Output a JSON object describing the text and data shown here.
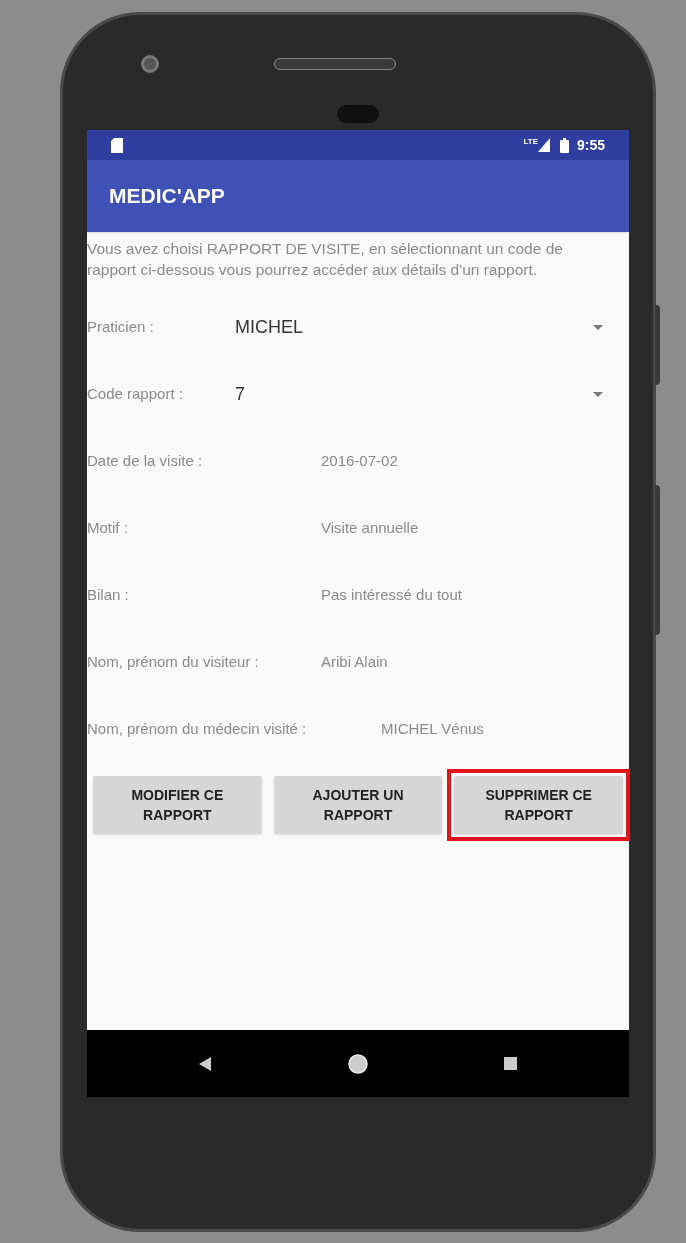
{
  "status_bar": {
    "network": "LTE",
    "time": "9:55"
  },
  "app_bar": {
    "title": "MEDIC'APP"
  },
  "intro": "Vous avez choisi RAPPORT DE VISITE, en sélectionnant un code de rapport ci-dessous vous pourrez accéder aux détails d'un rapport.",
  "spinners": [
    {
      "label": "Praticien :",
      "value": "MICHEL"
    },
    {
      "label": "Code rapport :",
      "value": "7"
    }
  ],
  "details": [
    {
      "label": "Date de la visite :",
      "value": "2016-07-02"
    },
    {
      "label": "Motif :",
      "value": "Visite annuelle"
    },
    {
      "label": "Bilan :",
      "value": "Pas intéressé du tout"
    },
    {
      "label": "Nom, prénom du visiteur :",
      "value": "Aribi Alain"
    },
    {
      "label": "Nom, prénom du médecin visité :",
      "value": "MICHEL Vénus"
    }
  ],
  "buttons": [
    {
      "label": "MODIFIER CE RAPPORT",
      "highlighted": false
    },
    {
      "label": "AJOUTER UN RAPPORT",
      "highlighted": false
    },
    {
      "label": "SUPPRIMER CE RAPPORT",
      "highlighted": true
    }
  ]
}
